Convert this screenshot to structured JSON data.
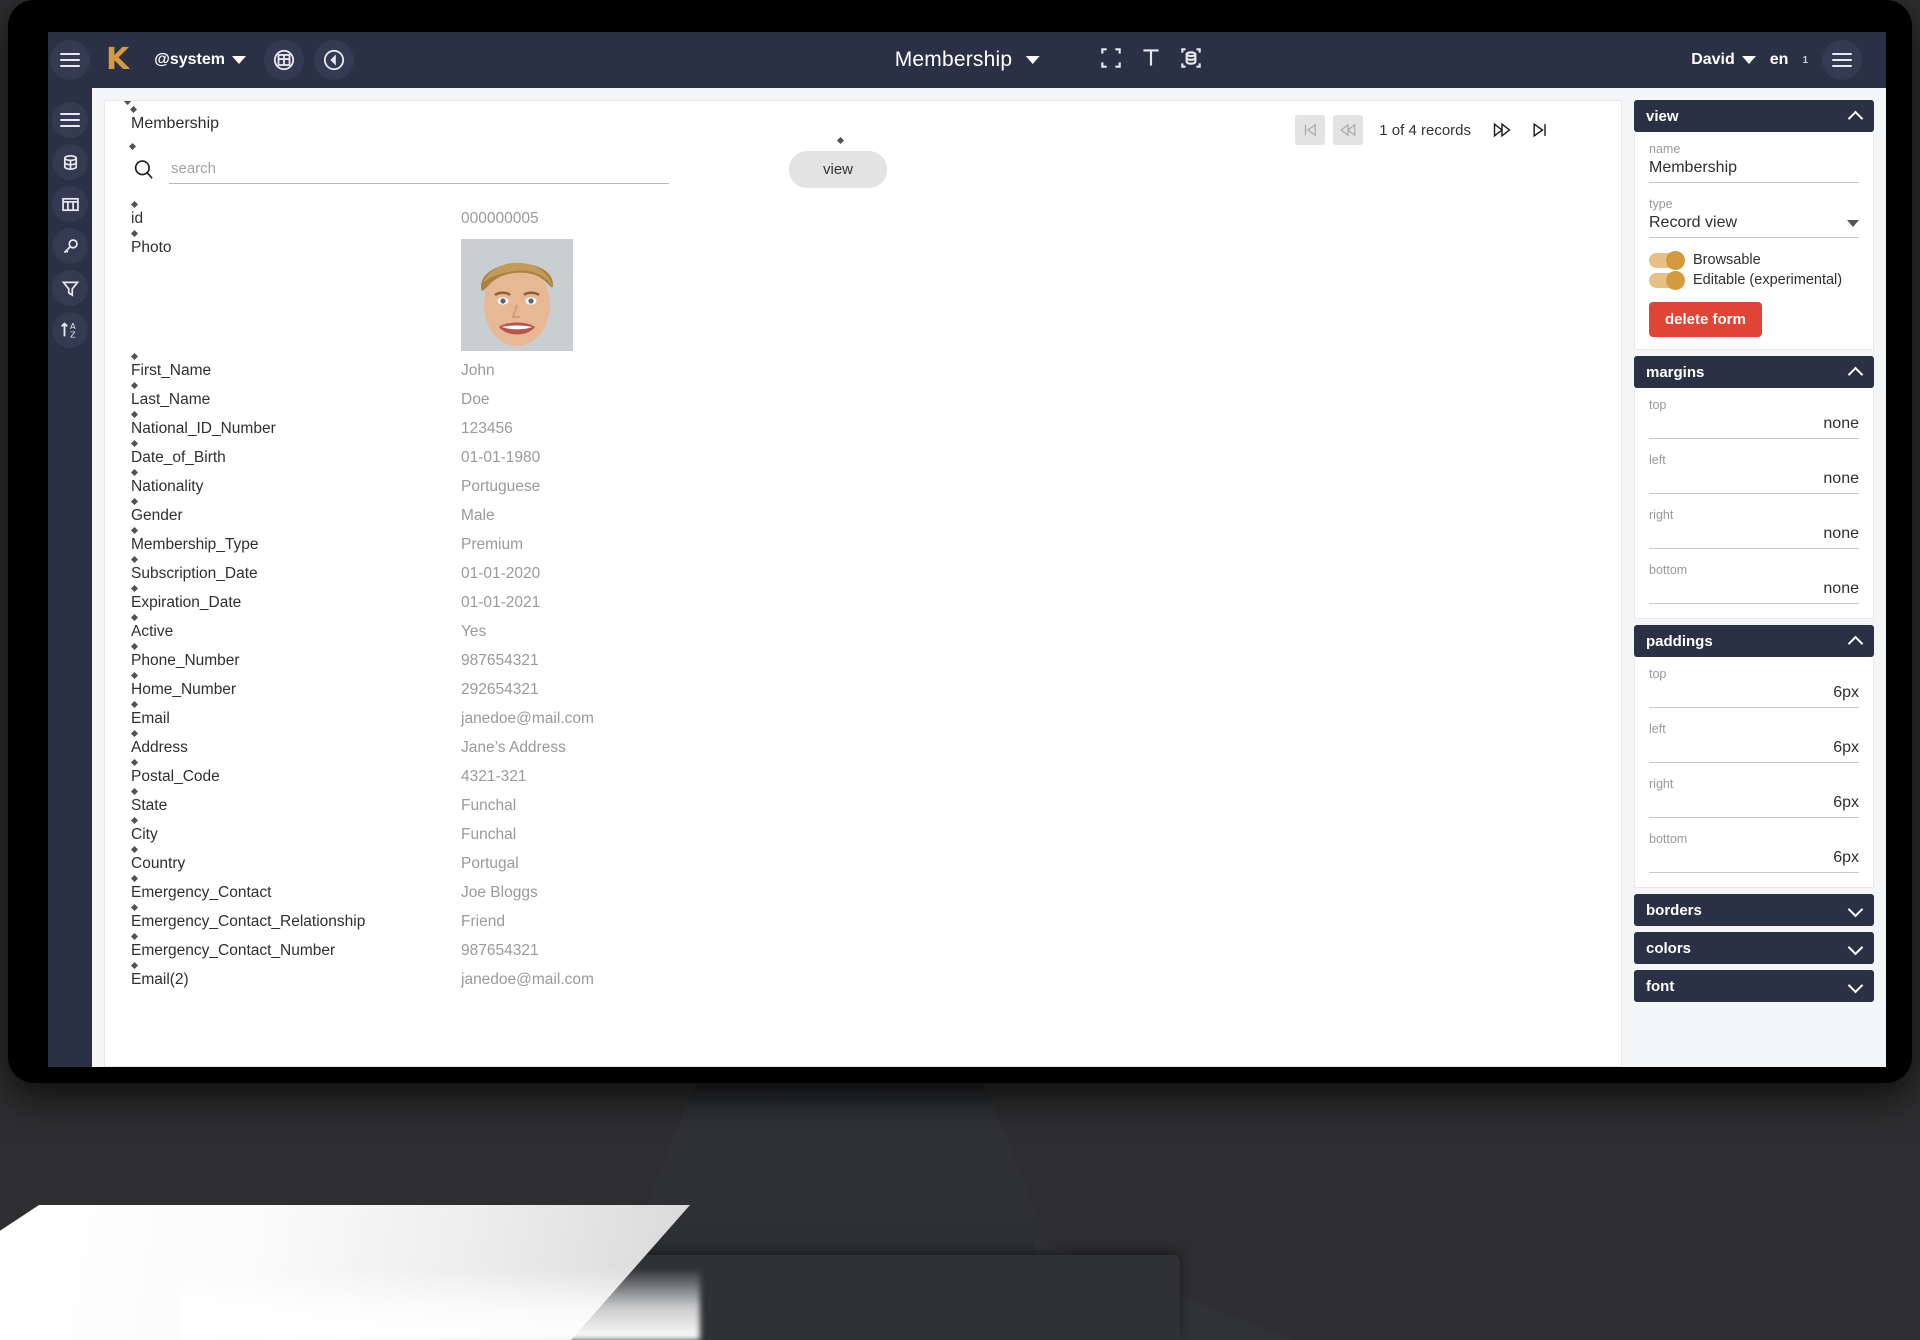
{
  "appbar": {
    "menu_icon": "hamburger-icon",
    "logo": "K",
    "system_label": "@system",
    "grid_icon": "grid-icon",
    "panel_icon": "left-panel-icon",
    "title": "Membership",
    "fullscreen_icon": "fullscreen-icon",
    "text_icon": "text-icon",
    "database_icon": "database-frame-icon",
    "user": "David",
    "lang": "en",
    "badge": "1",
    "right_menu_icon": "hamburger-icon"
  },
  "rail": {
    "items": [
      {
        "name": "menu",
        "icon": "hamburger-icon"
      },
      {
        "name": "database",
        "icon": "database-icon"
      },
      {
        "name": "table",
        "icon": "table-columns-icon"
      },
      {
        "name": "keys",
        "icon": "key-icon"
      },
      {
        "name": "filter",
        "icon": "filter-icon"
      },
      {
        "name": "sort",
        "icon": "sort-az-icon"
      }
    ]
  },
  "toolbar": {
    "title": "Membership",
    "pager": {
      "first_icon": "first-page-icon",
      "prev_icon": "prev-page-icon",
      "text": "1  of  4 records",
      "current": "1",
      "total": "4",
      "next_icon": "next-page-icon",
      "last_icon": "last-page-icon"
    },
    "search": {
      "icon": "search-icon",
      "placeholder": "search",
      "value": ""
    },
    "view_button": "view"
  },
  "record": {
    "fields": [
      {
        "label": "id",
        "value": "000000005",
        "type": "text"
      },
      {
        "label": "Photo",
        "value": "",
        "type": "photo"
      },
      {
        "label": "First_Name",
        "value": "John",
        "type": "text"
      },
      {
        "label": "Last_Name",
        "value": "Doe",
        "type": "text"
      },
      {
        "label": "National_ID_Number",
        "value": "123456",
        "type": "text"
      },
      {
        "label": "Date_of_Birth",
        "value": "01-01-1980",
        "type": "text"
      },
      {
        "label": "Nationality",
        "value": "Portuguese",
        "type": "text"
      },
      {
        "label": "Gender",
        "value": "Male",
        "type": "text"
      },
      {
        "label": "Membership_Type",
        "value": "Premium",
        "type": "text"
      },
      {
        "label": "Subscription_Date",
        "value": "01-01-2020",
        "type": "text"
      },
      {
        "label": "Expiration_Date",
        "value": "01-01-2021",
        "type": "text"
      },
      {
        "label": "Active",
        "value": "Yes",
        "type": "text"
      },
      {
        "label": "Phone_Number",
        "value": "987654321",
        "type": "text"
      },
      {
        "label": "Home_Number",
        "value": "292654321",
        "type": "text"
      },
      {
        "label": "Email",
        "value": "janedoe@mail.com",
        "type": "text"
      },
      {
        "label": "Address",
        "value": "Jane’s Address",
        "type": "text"
      },
      {
        "label": "Postal_Code",
        "value": "4321-321",
        "type": "text"
      },
      {
        "label": "State",
        "value": "Funchal",
        "type": "text"
      },
      {
        "label": "City",
        "value": "Funchal",
        "type": "text"
      },
      {
        "label": "Country",
        "value": "Portugal",
        "type": "text"
      },
      {
        "label": "Emergency_Contact",
        "value": "Joe Bloggs",
        "type": "text"
      },
      {
        "label": "Emergency_Contact_Relationship",
        "value": "Friend",
        "type": "text"
      },
      {
        "label": "Emergency_Contact_Number",
        "value": "987654321",
        "type": "text"
      },
      {
        "label": "Email(2)",
        "value": "janedoe@mail.com",
        "type": "text"
      }
    ]
  },
  "props": {
    "view": {
      "header": "view",
      "name_label": "name",
      "name_value": "Membership",
      "type_label": "type",
      "type_value": "Record view",
      "browsable_label": "Browsable",
      "editable_label": "Editable (experimental)",
      "delete_label": "delete form"
    },
    "margins": {
      "header": "margins",
      "top_label": "top",
      "top_value": "none",
      "left_label": "left",
      "left_value": "none",
      "right_label": "right",
      "right_value": "none",
      "bottom_label": "bottom",
      "bottom_value": "none"
    },
    "paddings": {
      "header": "paddings",
      "top_label": "top",
      "top_value": "6px",
      "left_label": "left",
      "left_value": "6px",
      "right_label": "right",
      "right_value": "6px",
      "bottom_label": "bottom",
      "bottom_value": "6px"
    },
    "borders": {
      "header": "borders"
    },
    "colors": {
      "header": "colors"
    },
    "font": {
      "header": "font"
    }
  },
  "colors": {
    "appbar": "#2b3145",
    "accent_orange": "#d39a3f",
    "danger_red": "#e04434",
    "content_bg": "#f4f5f7",
    "value_text": "#9a9a9a"
  }
}
